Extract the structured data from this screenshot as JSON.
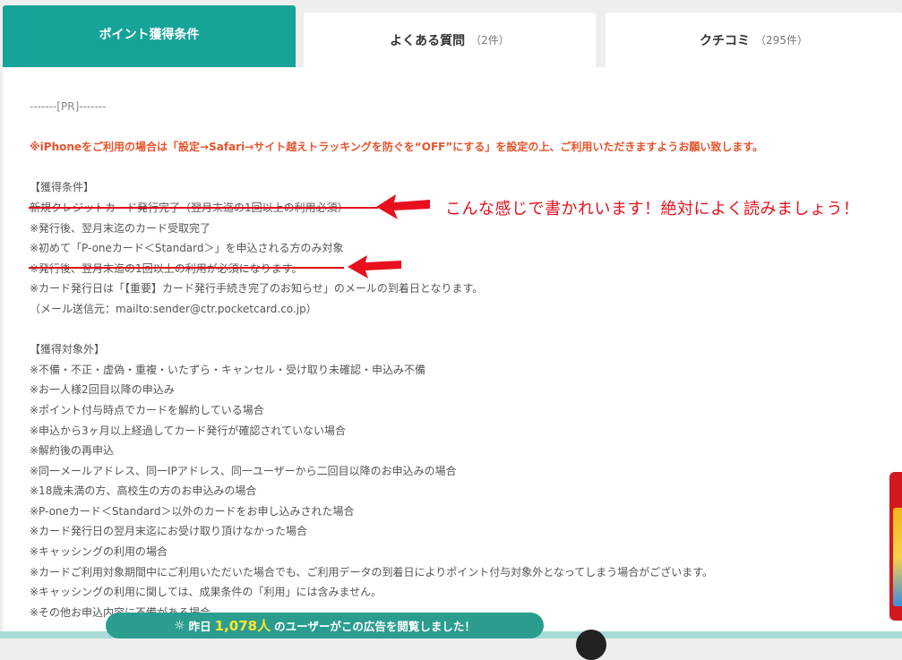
{
  "tabs": [
    {
      "label": "ポイント獲得条件",
      "count": "",
      "active": true
    },
    {
      "label": "よくある質問",
      "count": "（2件）",
      "active": false
    },
    {
      "label": "クチコミ",
      "count": "（295件）",
      "active": false
    }
  ],
  "content": {
    "pr": "-------[PR]-------",
    "warning": "※iPhoneをご利用の場合は「設定→Safari→サイト越えトラッキングを防ぐを“OFF”にする」を設定の上、ご利用いただきますようお願い致します。",
    "conditions_heading": "【獲得条件】",
    "conditions": [
      "新規クレジットカード発行完了（翌月末迄の1回以上の利用必須）",
      "※発行後、翌月末迄のカード受取完了",
      "※初めて「P-oneカード＜Standard＞」を申込される方のみ対象",
      "※発行後、翌月末迄の1回以上の利用が必須になります。",
      "※カード発行日は「【重要】カード発行手続き完了のお知らせ」のメールの到着日となります。",
      "（メール送信元：mailto:sender@ctr.pocketcard.co.jp）"
    ],
    "exclusions_heading": "【獲得対象外】",
    "exclusions": [
      "※不備・不正・虚偽・重複・いたずら・キャンセル・受け取り未確認・申込み不備",
      "※お一人様2回目以降の申込み",
      "※ポイント付与時点でカードを解約している場合",
      "※申込から3ヶ月以上経過してカード発行が確認されていない場合",
      "※解約後の再申込",
      "※同一メールアドレス、同一IPアドレス、同一ユーザーから二回目以降のお申込みの場合",
      "※18歳未満の方、高校生の方のお申込みの場合",
      "※P-oneカード＜Standard＞以外のカードをお申し込みされた場合",
      "※カード発行日の翌月末迄にお受け取り頂けなかった場合",
      "※キャッシングの利用の場合",
      "※カードご利用対象期間中にご利用いただいた場合でも、ご利用データの到着日によりポイント付与対象外となってしまう場合がございます。",
      "※キャッシングの利用に関しては、成果条件の「利用」には含みません。",
      "※その他お申込内容に不備がある場合"
    ]
  },
  "annotation": "こんな感じで書かれいます！絶対によく読みましょう！",
  "banner": {
    "icon": "lightbulb-icon",
    "prefix": "昨日",
    "count": "1,078人",
    "suffix": "のユーザーがこの広告を閲覧しました！"
  },
  "colors": {
    "accent": "#16a398",
    "warning": "#e8542c",
    "annotation": "#e8101e",
    "banner_bg": "#2a9d8f",
    "banner_count": "#ffe633"
  }
}
